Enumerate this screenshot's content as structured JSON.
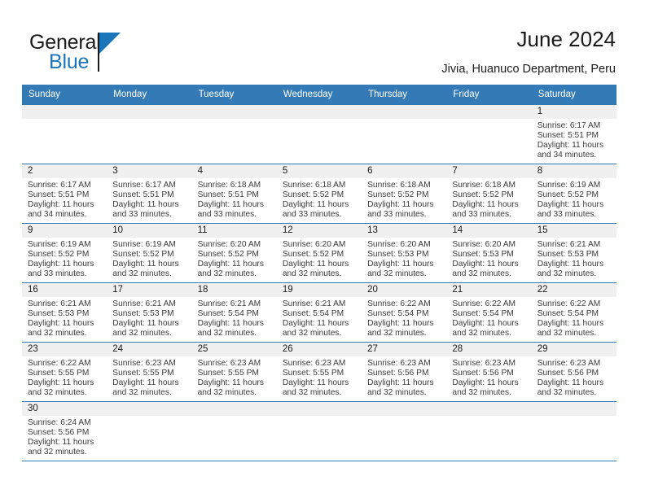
{
  "brand": {
    "name_top": "General",
    "name_bottom": "Blue",
    "color_dark": "#1a1a1a",
    "color_blue": "#1b75bb"
  },
  "header": {
    "title": "June 2024",
    "subtitle": "Jivia, Huanuco Department, Peru"
  },
  "theme": {
    "header_bg": "#337ab7",
    "header_text": "#ffffff",
    "daynum_band_bg": "#f0f0f0",
    "cell_text": "#3a3a3a",
    "grid_line": "#337ab7"
  },
  "weekday_headers": [
    "Sunday",
    "Monday",
    "Tuesday",
    "Wednesday",
    "Thursday",
    "Friday",
    "Saturday"
  ],
  "labels": {
    "sunrise_prefix": "Sunrise:",
    "sunset_prefix": "Sunset:",
    "daylight_prefix": "Daylight:"
  },
  "weeks": [
    [
      {
        "day": "",
        "lines": []
      },
      {
        "day": "",
        "lines": []
      },
      {
        "day": "",
        "lines": []
      },
      {
        "day": "",
        "lines": []
      },
      {
        "day": "",
        "lines": []
      },
      {
        "day": "",
        "lines": []
      },
      {
        "day": "1",
        "lines": [
          "Sunrise: 6:17 AM",
          "Sunset: 5:51 PM",
          "Daylight: 11 hours",
          "and 34 minutes."
        ]
      }
    ],
    [
      {
        "day": "2",
        "lines": [
          "Sunrise: 6:17 AM",
          "Sunset: 5:51 PM",
          "Daylight: 11 hours",
          "and 34 minutes."
        ]
      },
      {
        "day": "3",
        "lines": [
          "Sunrise: 6:17 AM",
          "Sunset: 5:51 PM",
          "Daylight: 11 hours",
          "and 33 minutes."
        ]
      },
      {
        "day": "4",
        "lines": [
          "Sunrise: 6:18 AM",
          "Sunset: 5:51 PM",
          "Daylight: 11 hours",
          "and 33 minutes."
        ]
      },
      {
        "day": "5",
        "lines": [
          "Sunrise: 6:18 AM",
          "Sunset: 5:52 PM",
          "Daylight: 11 hours",
          "and 33 minutes."
        ]
      },
      {
        "day": "6",
        "lines": [
          "Sunrise: 6:18 AM",
          "Sunset: 5:52 PM",
          "Daylight: 11 hours",
          "and 33 minutes."
        ]
      },
      {
        "day": "7",
        "lines": [
          "Sunrise: 6:18 AM",
          "Sunset: 5:52 PM",
          "Daylight: 11 hours",
          "and 33 minutes."
        ]
      },
      {
        "day": "8",
        "lines": [
          "Sunrise: 6:19 AM",
          "Sunset: 5:52 PM",
          "Daylight: 11 hours",
          "and 33 minutes."
        ]
      }
    ],
    [
      {
        "day": "9",
        "lines": [
          "Sunrise: 6:19 AM",
          "Sunset: 5:52 PM",
          "Daylight: 11 hours",
          "and 33 minutes."
        ]
      },
      {
        "day": "10",
        "lines": [
          "Sunrise: 6:19 AM",
          "Sunset: 5:52 PM",
          "Daylight: 11 hours",
          "and 32 minutes."
        ]
      },
      {
        "day": "11",
        "lines": [
          "Sunrise: 6:20 AM",
          "Sunset: 5:52 PM",
          "Daylight: 11 hours",
          "and 32 minutes."
        ]
      },
      {
        "day": "12",
        "lines": [
          "Sunrise: 6:20 AM",
          "Sunset: 5:52 PM",
          "Daylight: 11 hours",
          "and 32 minutes."
        ]
      },
      {
        "day": "13",
        "lines": [
          "Sunrise: 6:20 AM",
          "Sunset: 5:53 PM",
          "Daylight: 11 hours",
          "and 32 minutes."
        ]
      },
      {
        "day": "14",
        "lines": [
          "Sunrise: 6:20 AM",
          "Sunset: 5:53 PM",
          "Daylight: 11 hours",
          "and 32 minutes."
        ]
      },
      {
        "day": "15",
        "lines": [
          "Sunrise: 6:21 AM",
          "Sunset: 5:53 PM",
          "Daylight: 11 hours",
          "and 32 minutes."
        ]
      }
    ],
    [
      {
        "day": "16",
        "lines": [
          "Sunrise: 6:21 AM",
          "Sunset: 5:53 PM",
          "Daylight: 11 hours",
          "and 32 minutes."
        ]
      },
      {
        "day": "17",
        "lines": [
          "Sunrise: 6:21 AM",
          "Sunset: 5:53 PM",
          "Daylight: 11 hours",
          "and 32 minutes."
        ]
      },
      {
        "day": "18",
        "lines": [
          "Sunrise: 6:21 AM",
          "Sunset: 5:54 PM",
          "Daylight: 11 hours",
          "and 32 minutes."
        ]
      },
      {
        "day": "19",
        "lines": [
          "Sunrise: 6:21 AM",
          "Sunset: 5:54 PM",
          "Daylight: 11 hours",
          "and 32 minutes."
        ]
      },
      {
        "day": "20",
        "lines": [
          "Sunrise: 6:22 AM",
          "Sunset: 5:54 PM",
          "Daylight: 11 hours",
          "and 32 minutes."
        ]
      },
      {
        "day": "21",
        "lines": [
          "Sunrise: 6:22 AM",
          "Sunset: 5:54 PM",
          "Daylight: 11 hours",
          "and 32 minutes."
        ]
      },
      {
        "day": "22",
        "lines": [
          "Sunrise: 6:22 AM",
          "Sunset: 5:54 PM",
          "Daylight: 11 hours",
          "and 32 minutes."
        ]
      }
    ],
    [
      {
        "day": "23",
        "lines": [
          "Sunrise: 6:22 AM",
          "Sunset: 5:55 PM",
          "Daylight: 11 hours",
          "and 32 minutes."
        ]
      },
      {
        "day": "24",
        "lines": [
          "Sunrise: 6:23 AM",
          "Sunset: 5:55 PM",
          "Daylight: 11 hours",
          "and 32 minutes."
        ]
      },
      {
        "day": "25",
        "lines": [
          "Sunrise: 6:23 AM",
          "Sunset: 5:55 PM",
          "Daylight: 11 hours",
          "and 32 minutes."
        ]
      },
      {
        "day": "26",
        "lines": [
          "Sunrise: 6:23 AM",
          "Sunset: 5:55 PM",
          "Daylight: 11 hours",
          "and 32 minutes."
        ]
      },
      {
        "day": "27",
        "lines": [
          "Sunrise: 6:23 AM",
          "Sunset: 5:56 PM",
          "Daylight: 11 hours",
          "and 32 minutes."
        ]
      },
      {
        "day": "28",
        "lines": [
          "Sunrise: 6:23 AM",
          "Sunset: 5:56 PM",
          "Daylight: 11 hours",
          "and 32 minutes."
        ]
      },
      {
        "day": "29",
        "lines": [
          "Sunrise: 6:23 AM",
          "Sunset: 5:56 PM",
          "Daylight: 11 hours",
          "and 32 minutes."
        ]
      }
    ],
    [
      {
        "day": "30",
        "lines": [
          "Sunrise: 6:24 AM",
          "Sunset: 5:56 PM",
          "Daylight: 11 hours",
          "and 32 minutes."
        ]
      },
      {
        "day": "",
        "lines": []
      },
      {
        "day": "",
        "lines": []
      },
      {
        "day": "",
        "lines": []
      },
      {
        "day": "",
        "lines": []
      },
      {
        "day": "",
        "lines": []
      },
      {
        "day": "",
        "lines": []
      }
    ]
  ]
}
